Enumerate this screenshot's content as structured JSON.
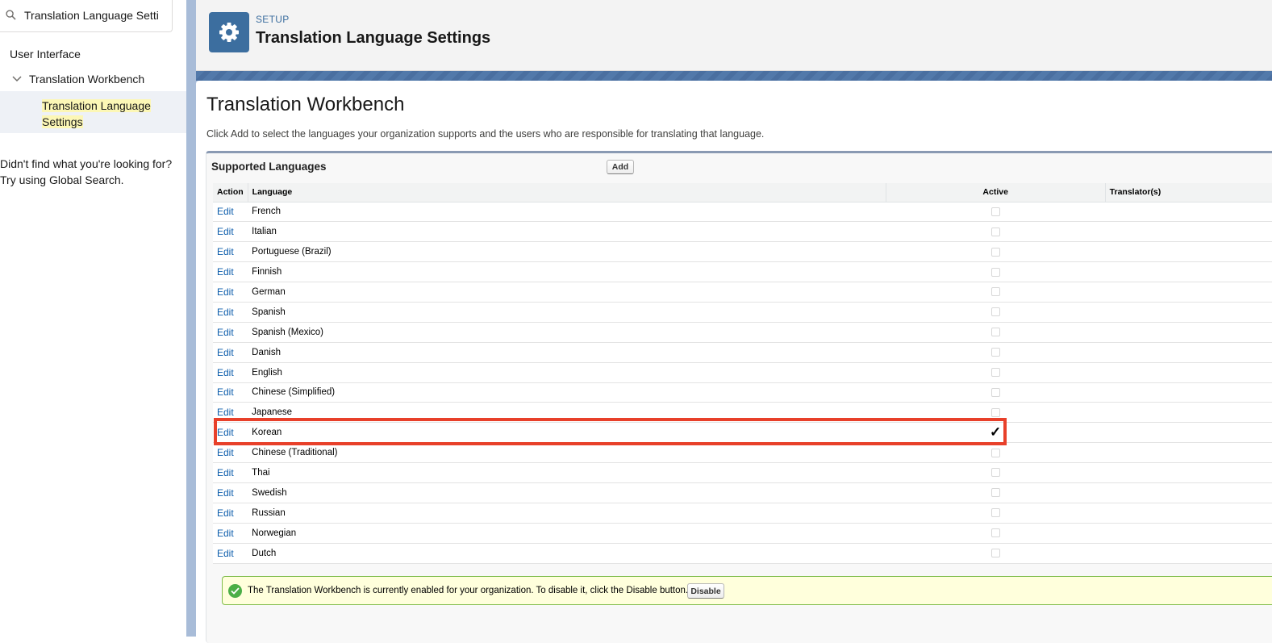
{
  "sidebar": {
    "search_value": "Translation Language Settings",
    "tree": {
      "user_interface": "User Interface",
      "translation_workbench": "Translation Workbench",
      "selected_line1": "Translation Language",
      "selected_line2": "Settings"
    },
    "help_line1": "Didn't find what you're looking for?",
    "help_line2": "Try using Global Search."
  },
  "header": {
    "eyebrow": "SETUP",
    "title": "Translation Language Settings",
    "icon": "gear-icon"
  },
  "main": {
    "heading": "Translation Workbench",
    "intro": "Click Add to select the languages your organization supports and the users who are responsible for translating that language.",
    "panel_title": "Supported Languages",
    "add_label": "Add",
    "columns": [
      "Action",
      "Language",
      "Active",
      "Translator(s)"
    ],
    "edit_label": "Edit",
    "rows": [
      {
        "language": "French",
        "active": false
      },
      {
        "language": "Italian",
        "active": false
      },
      {
        "language": "Portuguese (Brazil)",
        "active": false
      },
      {
        "language": "Finnish",
        "active": false
      },
      {
        "language": "German",
        "active": false
      },
      {
        "language": "Spanish",
        "active": false
      },
      {
        "language": "Spanish (Mexico)",
        "active": false
      },
      {
        "language": "Danish",
        "active": false
      },
      {
        "language": "English",
        "active": false
      },
      {
        "language": "Chinese (Simplified)",
        "active": false
      },
      {
        "language": "Japanese",
        "active": false
      },
      {
        "language": "Korean",
        "active": true
      },
      {
        "language": "Chinese (Traditional)",
        "active": false
      },
      {
        "language": "Thai",
        "active": false
      },
      {
        "language": "Swedish",
        "active": false
      },
      {
        "language": "Russian",
        "active": false
      },
      {
        "language": "Norwegian",
        "active": false
      },
      {
        "language": "Dutch",
        "active": false
      }
    ],
    "highlight_color": "#e8402a"
  },
  "notice": {
    "text": "The Translation Workbench is currently enabled for your organization. To disable it, click the Disable button.",
    "disable_label": "Disable",
    "icon": "check-circle-icon"
  }
}
